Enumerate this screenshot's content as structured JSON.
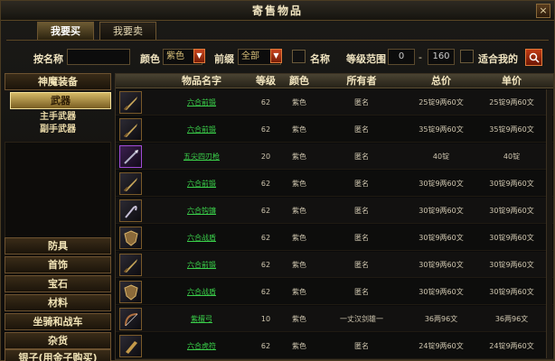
{
  "window": {
    "title": "寄售物品",
    "close_label": "×"
  },
  "tabs": [
    {
      "label": "我要买",
      "active": true
    },
    {
      "label": "我要卖",
      "active": false
    }
  ],
  "filters": {
    "seller_label": "按名称",
    "seller_value": "",
    "color_label": "颜色",
    "color_value": "紫色",
    "level_label": "前缀",
    "level_value": "全部",
    "name_label": "名称",
    "range_label": "等级范围",
    "range_min": "0",
    "range_sep": "-",
    "range_max": "160",
    "suitable_label": "适合我的",
    "search_icon": "search-icon",
    "dropdown_icon": "▼"
  },
  "sidebar": {
    "categories_top": [
      {
        "label": "神魔装备",
        "active": false
      },
      {
        "label": "武器",
        "active": true
      }
    ],
    "subcategories": [
      {
        "label": "主手武器"
      },
      {
        "label": "副手武器"
      }
    ],
    "categories_bottom": [
      {
        "label": "防具"
      },
      {
        "label": "首饰"
      },
      {
        "label": "宝石"
      },
      {
        "label": "材料"
      },
      {
        "label": "坐骑和战车"
      },
      {
        "label": "杂货"
      },
      {
        "label": "银子(用金子购买)"
      }
    ]
  },
  "table": {
    "headers": [
      "物品名字",
      "等级",
      "颜色",
      "所有者",
      "总价",
      "单价"
    ],
    "rows": [
      {
        "name": "六合前锻",
        "level": "62",
        "color": "紫色",
        "owner": "匿名",
        "total": "25锭9两60文",
        "unit": "25锭9两60文",
        "icon": "sword-icon"
      },
      {
        "name": "六合前锻",
        "level": "62",
        "color": "紫色",
        "owner": "匿名",
        "total": "35锭9两60文",
        "unit": "35锭9两60文",
        "icon": "sword-icon"
      },
      {
        "name": "五尖四刃枪",
        "level": "20",
        "color": "紫色",
        "owner": "匿名",
        "total": "40锭",
        "unit": "40锭",
        "icon": "spear-icon"
      },
      {
        "name": "六合前锻",
        "level": "62",
        "color": "紫色",
        "owner": "匿名",
        "total": "30锭9两60文",
        "unit": "30锭9两60文",
        "icon": "sword-icon"
      },
      {
        "name": "六合钩镰",
        "level": "62",
        "color": "紫色",
        "owner": "匿名",
        "total": "30锭9两60文",
        "unit": "30锭9两60文",
        "icon": "hook-icon"
      },
      {
        "name": "六合战盾",
        "level": "62",
        "color": "紫色",
        "owner": "匿名",
        "total": "30锭9两60文",
        "unit": "30锭9两60文",
        "icon": "shield-icon"
      },
      {
        "name": "六合前锻",
        "level": "62",
        "color": "紫色",
        "owner": "匿名",
        "total": "30锭9两60文",
        "unit": "30锭9两60文",
        "icon": "sword-icon"
      },
      {
        "name": "六合战盾",
        "level": "62",
        "color": "紫色",
        "owner": "匿名",
        "total": "30锭9两60文",
        "unit": "30锭9两60文",
        "icon": "shield-icon"
      },
      {
        "name": "紫檀弓",
        "level": "10",
        "color": "紫色",
        "owner": "一丈汉剑雄一",
        "total": "36两96文",
        "unit": "36两96文",
        "icon": "bow-icon"
      },
      {
        "name": "六合虎符",
        "level": "62",
        "color": "紫色",
        "owner": "匿名",
        "total": "24锭9两60文",
        "unit": "24锭9两60文",
        "icon": "tiger-talisman-icon"
      }
    ]
  },
  "colors": {
    "item_name": "#3ad04a",
    "accent": "#c9441d",
    "gold_text": "#f1e3b6"
  }
}
